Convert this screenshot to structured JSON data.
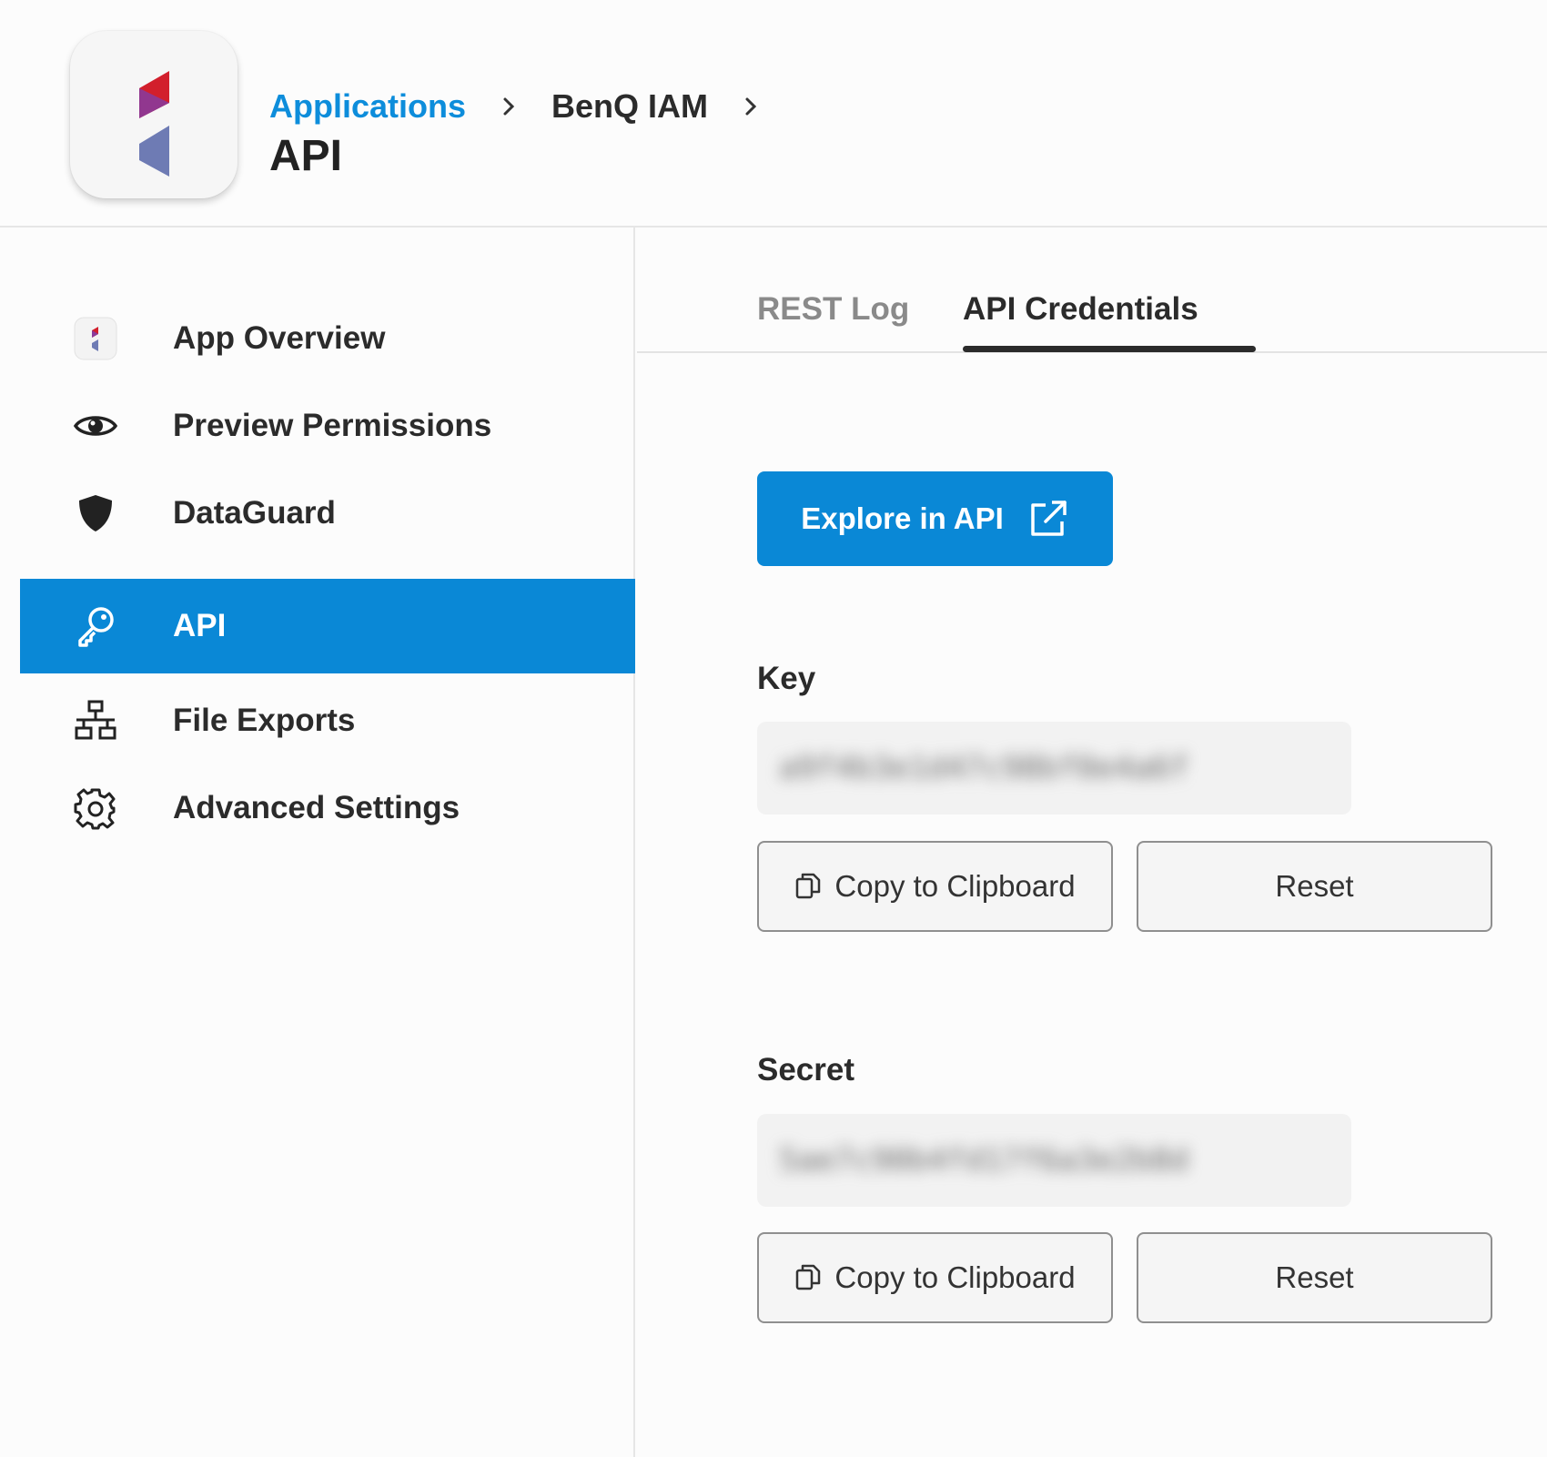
{
  "header": {
    "breadcrumb": [
      {
        "label": "Applications"
      },
      {
        "label": "BenQ IAM"
      }
    ],
    "title": "API"
  },
  "sidebar": {
    "items": [
      {
        "label": "App Overview",
        "icon": "app-logo-icon"
      },
      {
        "label": "Preview Permissions",
        "icon": "eye-icon"
      },
      {
        "label": "DataGuard",
        "icon": "shield-icon"
      },
      {
        "label": "API",
        "icon": "key-icon",
        "active": true
      },
      {
        "label": "File Exports",
        "icon": "network-icon"
      },
      {
        "label": "Advanced Settings",
        "icon": "gear-icon"
      }
    ]
  },
  "tabs": [
    {
      "label": "REST Log"
    },
    {
      "label": "API Credentials",
      "active": true
    }
  ],
  "explore_button": {
    "label": "Explore in API",
    "icon": "external-link-icon"
  },
  "credentials": {
    "key": {
      "label": "Key",
      "value": "a9f4b3e1d47c98bf0e4a6f",
      "copy_label": "Copy to Clipboard",
      "reset_label": "Reset"
    },
    "secret": {
      "label": "Secret",
      "value": "5ae7c90b4fd17f6a3e2b8d",
      "copy_label": "Copy to Clipboard",
      "reset_label": "Reset"
    }
  },
  "colors": {
    "accent": "#0a88d6",
    "link": "#0d8ddb",
    "logo_red": "#d21f2c",
    "logo_purple": "#8a3a9a",
    "logo_slate": "#6e7bb4"
  }
}
